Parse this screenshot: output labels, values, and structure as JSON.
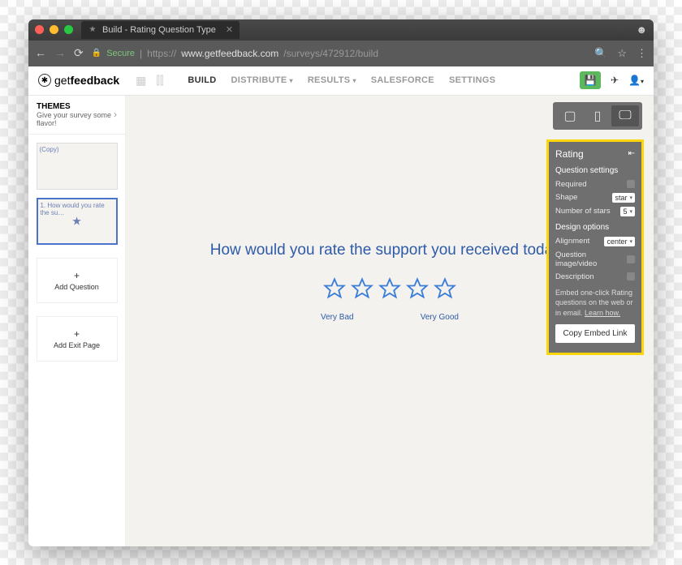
{
  "browser": {
    "tab_title": "Build - Rating Question Type",
    "secure_label": "Secure",
    "url_protocol": "https://",
    "url_host": "www.getfeedback.com",
    "url_path": "/surveys/472912/build"
  },
  "app": {
    "logo_prefix": "get",
    "logo_bold": "feedback",
    "nav": {
      "build": "BUILD",
      "distribute": "DISTRIBUTE",
      "results": "RESULTS",
      "salesforce": "SALESFORCE",
      "settings": "SETTINGS"
    }
  },
  "sidebar": {
    "themes_title": "THEMES",
    "themes_sub": "Give your survey some flavor!",
    "thumb1_label": "(Copy)",
    "thumb2_label": "1. How would you rate the su…",
    "add_question": "Add Question",
    "add_exit": "Add Exit Page"
  },
  "question": {
    "text": "How would you rate the support you received today?",
    "left_label": "Very Bad",
    "right_label": "Very Good"
  },
  "panel": {
    "title": "Rating",
    "section1": "Question settings",
    "required_label": "Required",
    "shape_label": "Shape",
    "shape_value": "star",
    "numstars_label": "Number of stars",
    "numstars_value": "5",
    "section2": "Design options",
    "alignment_label": "Alignment",
    "alignment_value": "center",
    "qimage_label": "Question image/video",
    "desc_label": "Description",
    "embed_text": "Embed one-click Rating questions on the web or in email. ",
    "learn_how": "Learn how.",
    "copy_btn": "Copy Embed Link"
  }
}
